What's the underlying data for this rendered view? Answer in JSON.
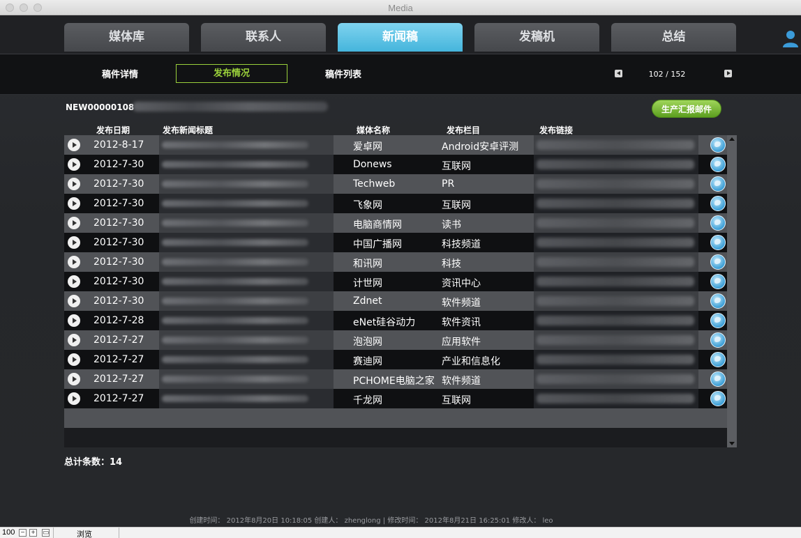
{
  "window": {
    "title": "Media"
  },
  "tabs": [
    "媒体库",
    "联系人",
    "新闻稿",
    "发稿机",
    "总结"
  ],
  "subnav": {
    "items": [
      "稿件详情",
      "发布情况",
      "稿件列表"
    ],
    "pager": "102 / 152"
  },
  "doc": {
    "id": "NEW00000108",
    "report_button": "生产汇报邮件"
  },
  "columns": [
    "发布日期",
    "发布新闻标题",
    "媒体名称",
    "发布栏目",
    "发布链接"
  ],
  "rows": [
    {
      "date": "2012-8-17",
      "media": "爱卓网",
      "column": "Android安卓评测"
    },
    {
      "date": "2012-7-30",
      "media": "Donews",
      "column": "互联网"
    },
    {
      "date": "2012-7-30",
      "media": "Techweb",
      "column": "PR"
    },
    {
      "date": "2012-7-30",
      "media": "飞象网",
      "column": "互联网"
    },
    {
      "date": "2012-7-30",
      "media": "电脑商情网",
      "column": "读书"
    },
    {
      "date": "2012-7-30",
      "media": "中国广播网",
      "column": "科技频道"
    },
    {
      "date": "2012-7-30",
      "media": "和讯网",
      "column": "科技"
    },
    {
      "date": "2012-7-30",
      "media": "计世网",
      "column": "资讯中心"
    },
    {
      "date": "2012-7-30",
      "media": "Zdnet",
      "column": "软件频道"
    },
    {
      "date": "2012-7-28",
      "media": "eNet硅谷动力",
      "column": "软件资讯"
    },
    {
      "date": "2012-7-27",
      "media": "泡泡网",
      "column": "应用软件"
    },
    {
      "date": "2012-7-27",
      "media": "赛迪网",
      "column": "产业和信息化"
    },
    {
      "date": "2012-7-27",
      "media": "PCHOME电脑之家",
      "column": "软件频道"
    },
    {
      "date": "2012-7-27",
      "media": "千龙网",
      "column": "互联网"
    }
  ],
  "total": "总计条数：14",
  "footer": "创建时间：  2012年8月20日  10:18:05 创建人：  zhenglong | 修改时间：  2012年8月21日  16:25:01 修改人：  leo",
  "statusbar": {
    "zoom": "100",
    "mode": "浏览"
  },
  "colors": {
    "accent_active_tab": "#45b5dc",
    "active_subnav": "#9bd13b",
    "report_button": "#6fb52b"
  }
}
